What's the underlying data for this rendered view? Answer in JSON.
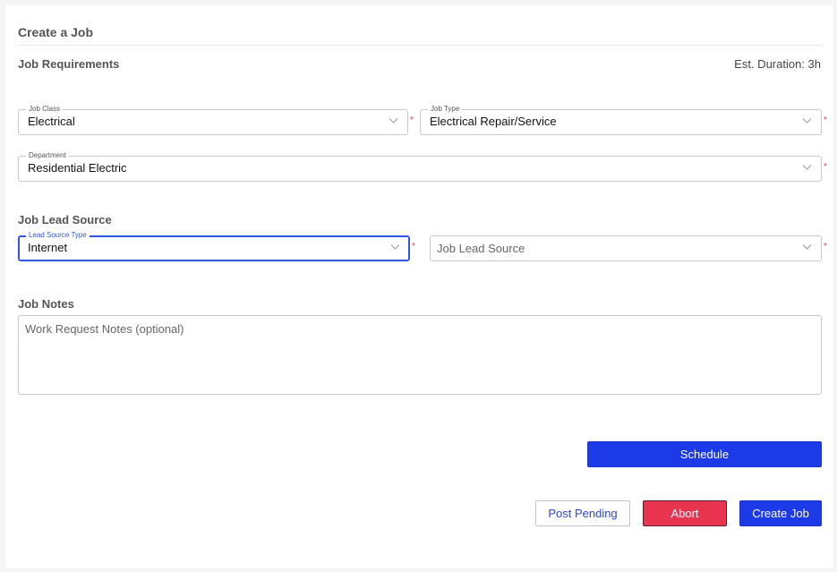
{
  "form": {
    "title": "Create a Job",
    "requirements_heading": "Job Requirements",
    "est_duration": "Est. Duration: 3h",
    "required_marker": "*"
  },
  "fields": {
    "job_class": {
      "label": "Job Class",
      "value": "Electrical"
    },
    "job_type": {
      "label": "Job Type",
      "value": "Electrical Repair/Service"
    },
    "department": {
      "label": "Department",
      "value": "Residential Electric"
    },
    "lead_source_type": {
      "label": "Lead Source Type",
      "value": "Internet"
    },
    "job_lead_source": {
      "placeholder": "Job Lead Source"
    }
  },
  "lead_source": {
    "heading": "Job Lead Source"
  },
  "notes": {
    "heading": "Job Notes",
    "placeholder": "Work Request Notes (optional)"
  },
  "buttons": {
    "schedule": "Schedule",
    "post_pending": "Post Pending",
    "abort": "Abort",
    "create_job": "Create Job"
  },
  "colors": {
    "primary": "#1d3ae8",
    "danger": "#e8344f",
    "required": "#e53959",
    "focus": "#2f55e4"
  },
  "icons": {
    "dropdown": "chevron-down-icon"
  }
}
